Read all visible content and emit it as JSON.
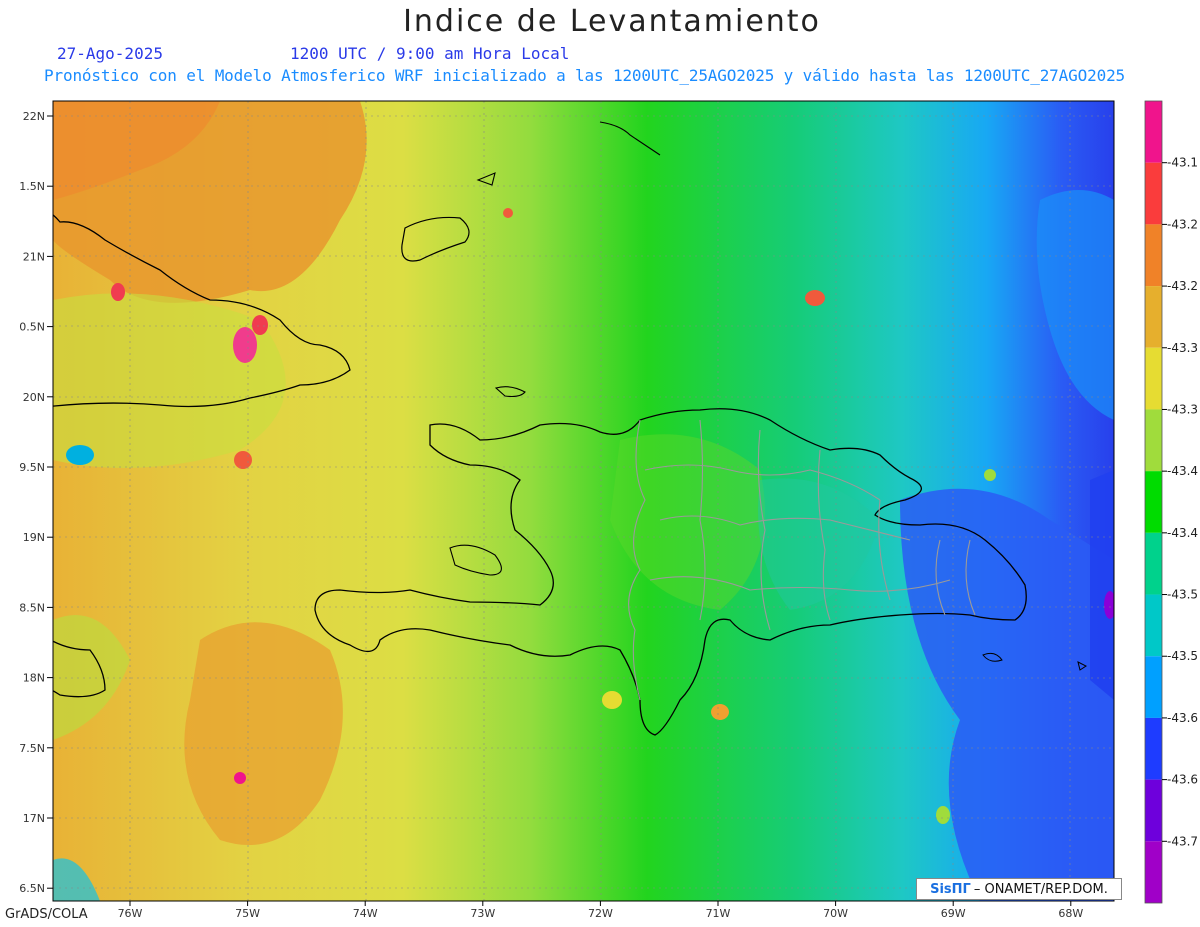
{
  "header": {
    "title": "Indice de Levantamiento",
    "date": "27-Ago-2025",
    "time": "1200 UTC / 9:00 am Hora Local",
    "forecast": "Pronóstico con el Modelo Atmosferico WRF inicializado a las 1200UTC_25AGO2025 y válido hasta las  1200UTC_27AGO2025"
  },
  "map": {
    "lat_labels": [
      "22N",
      "1.5N",
      "21N",
      "0.5N",
      "20N",
      "9.5N",
      "19N",
      "8.5N",
      "18N",
      "7.5N",
      "17N",
      "6.5N"
    ],
    "lon_labels": [
      "76W",
      "75W",
      "74W",
      "73W",
      "72W",
      "71W",
      "70W",
      "69W",
      "68W"
    ]
  },
  "colorbar": {
    "labels": [
      "-43.1",
      "-43.2",
      "-43.2",
      "-43.3",
      "-43.3",
      "-43.4",
      "-43.4",
      "-43.5",
      "-43.5",
      "-43.6",
      "-43.6",
      "-43.7"
    ],
    "colors": [
      "#f0148c",
      "#fa3c3c",
      "#f08228",
      "#e6af2d",
      "#e6dc32",
      "#a0dc3c",
      "#00dc00",
      "#00d28c",
      "#00c8c8",
      "#00a0ff",
      "#1e3cff",
      "#6e00dc",
      "#a000c8"
    ]
  },
  "footer": {
    "credit_logo": "SisПΓ",
    "credit_text": "– ONAMET/REP.DOM.",
    "software": "GrADS/COLA"
  }
}
